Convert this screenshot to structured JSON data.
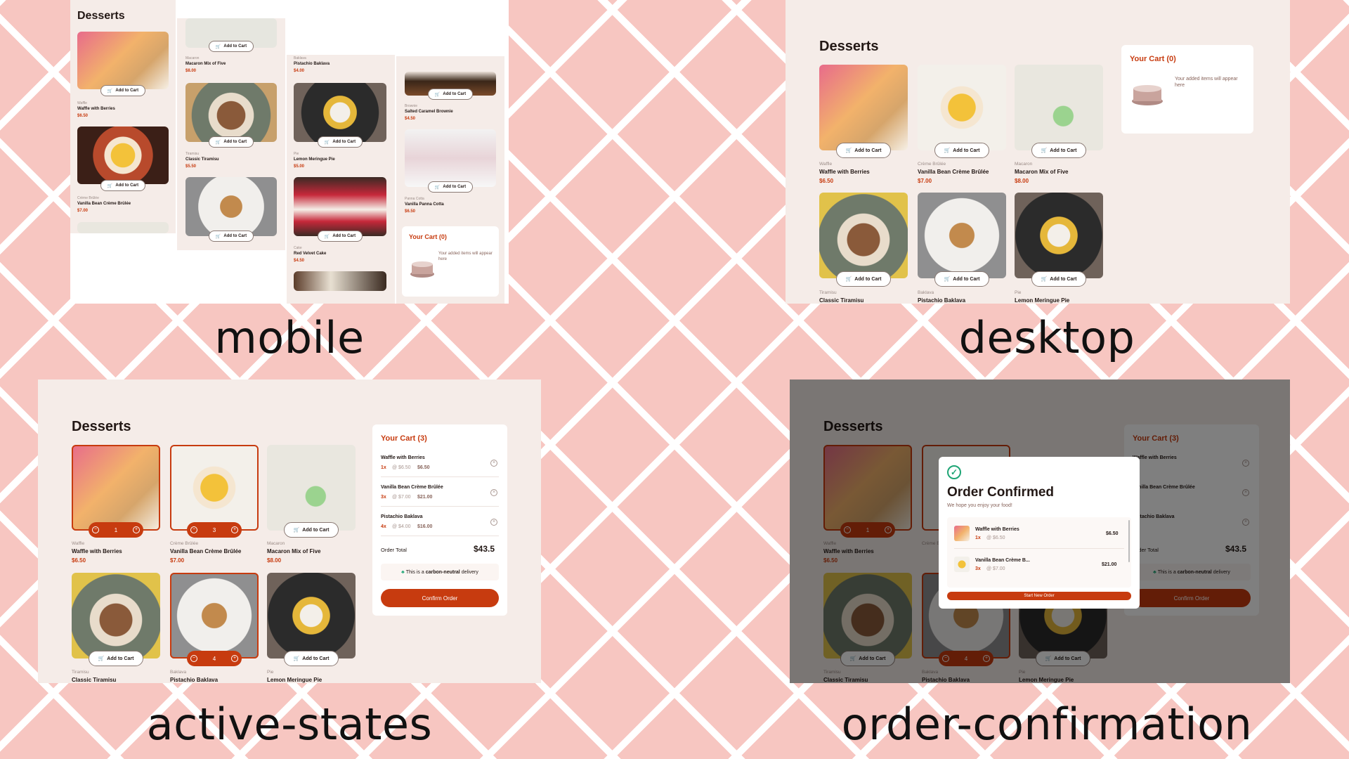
{
  "heading": "Desserts",
  "add_to_cart": "Add to Cart",
  "captions": {
    "mobile": "mobile",
    "desktop": "desktop",
    "active": "active-states",
    "confirm": "order-confirmation"
  },
  "products": [
    {
      "category": "Waffle",
      "name": "Waffle with Berries",
      "price": "$6.50"
    },
    {
      "category": "Crème Brûlée",
      "name": "Vanilla Bean Crème Brûlée",
      "price": "$7.00"
    },
    {
      "category": "Macaron",
      "name": "Macaron Mix of Five",
      "price": "$8.00"
    },
    {
      "category": "Tiramisu",
      "name": "Classic Tiramisu",
      "price": "$5.50"
    },
    {
      "category": "Baklava",
      "name": "Pistachio Baklava",
      "price": "$4.00"
    },
    {
      "category": "Pie",
      "name": "Lemon Meringue Pie",
      "price": "$5.00"
    },
    {
      "category": "Cake",
      "name": "Red Velvet Cake",
      "price": "$4.50"
    },
    {
      "category": "Brownie",
      "name": "Salted Caramel Brownie",
      "price": "$4.50"
    },
    {
      "category": "Panna Cotta",
      "name": "Vanilla Panna Cotta",
      "price": "$6.50"
    }
  ],
  "cart_empty": {
    "title": "Your Cart (0)",
    "text": "Your added items will appear here"
  },
  "cart_full": {
    "title": "Your Cart (3)",
    "items": [
      {
        "name": "Waffle with Berries",
        "qty": "1x",
        "unit": "@ $6.50",
        "total": "$6.50"
      },
      {
        "name": "Vanilla Bean Crème Brûlée",
        "qty": "3x",
        "unit": "@ $7.00",
        "total": "$21.00"
      },
      {
        "name": "Pistachio Baklava",
        "qty": "4x",
        "unit": "@ $4.00",
        "total": "$16.00"
      }
    ],
    "order_total_label": "Order Total",
    "order_total": "$43.5",
    "carbon_pre": "This is a",
    "carbon_bold": "carbon-neutral",
    "carbon_post": "delivery",
    "confirm": "Confirm Order"
  },
  "quantities": {
    "waffle": "1",
    "creme": "3",
    "baklava": "4"
  },
  "modal": {
    "title": "Order Confirmed",
    "subtitle": "We hope you enjoy your food!",
    "items": [
      {
        "name": "Waffle with Berries",
        "qty": "1x",
        "unit": "@ $6.50",
        "total": "$6.50"
      },
      {
        "name": "Vanilla Bean Crème B...",
        "qty": "3x",
        "unit": "@ $7.00",
        "total": "$21.00"
      }
    ],
    "button": "Start New Order"
  },
  "colors": {
    "accent": "#c73b0f",
    "rose_bg": "#fcf8f6",
    "text": "#231815",
    "green": "#1ea575",
    "backdrop": "#f7c6c1"
  },
  "icons": [
    "cart-icon",
    "decrement-icon",
    "increment-icon",
    "remove-icon",
    "tree-icon",
    "check-circle-icon",
    "empty-cake-icon"
  ]
}
